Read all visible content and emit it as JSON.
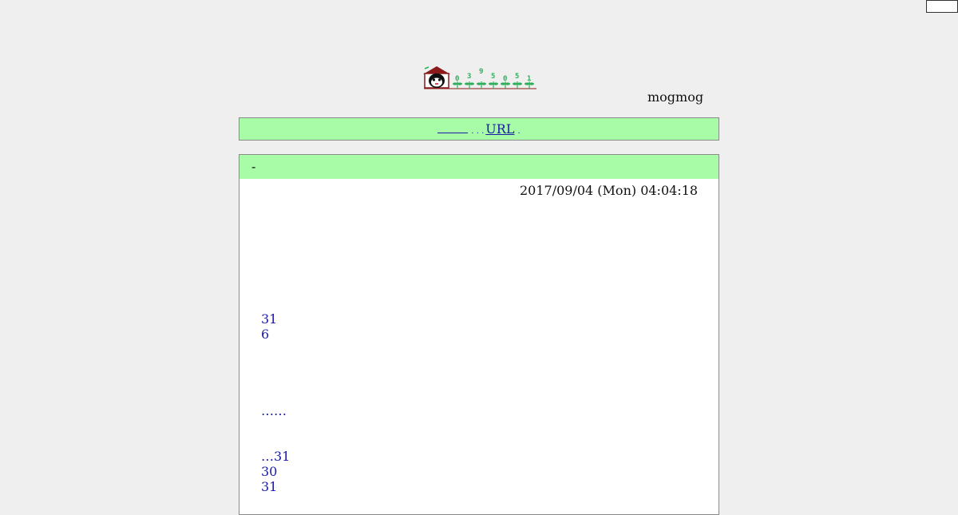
{
  "header": {
    "owner_name": "mogmog",
    "counter_digits": [
      "0",
      "3",
      "9",
      "5",
      "0",
      "5",
      "1"
    ]
  },
  "nav": {
    "link_url": "URL",
    "dots": ". . .",
    "tail": "."
  },
  "entry": {
    "title": "-",
    "date": "2017/09/04 (Mon) 04:04:18",
    "lines": [
      "31",
      "6",
      "……",
      "…31",
      "30",
      "31"
    ]
  },
  "colors": {
    "page_background": "#efefef",
    "header_band": "#a8fca8",
    "link": "#1a1aa6",
    "counter": "#2fae5a",
    "house_roof": "#8b1a1a"
  },
  "icons": {
    "logo": "house-with-creature-icon",
    "counter_sprout": "sprout-icon"
  }
}
